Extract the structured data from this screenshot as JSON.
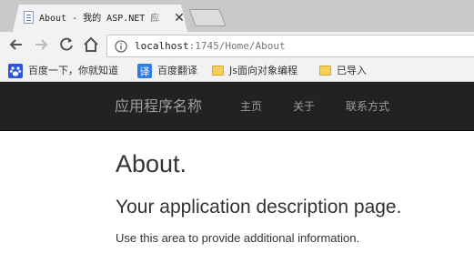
{
  "browser": {
    "tab": {
      "title": "About - 我的 ASP.NET 应",
      "close_glyph": "✕"
    },
    "address": {
      "host": "localhost",
      "path": ":1745/Home/About"
    },
    "bookmarks": [
      {
        "label": "百度一下，你就知道",
        "icon": "baidu-paw-icon"
      },
      {
        "label": "百度翻译",
        "icon": "translate-icon"
      },
      {
        "label": "Js面向对象编程",
        "icon": "folder-icon"
      },
      {
        "label": "已导入",
        "icon": "folder-icon"
      }
    ]
  },
  "site": {
    "brand": "应用程序名称",
    "nav": [
      "主页",
      "关于",
      "联系方式"
    ]
  },
  "content": {
    "title": "About.",
    "subtitle": "Your application description page.",
    "body": "Use this area to provide additional information."
  },
  "colors": {
    "navbar_bg": "#222222",
    "navbar_text": "#9d9d9d",
    "chrome_bg": "#f2f2f2"
  }
}
